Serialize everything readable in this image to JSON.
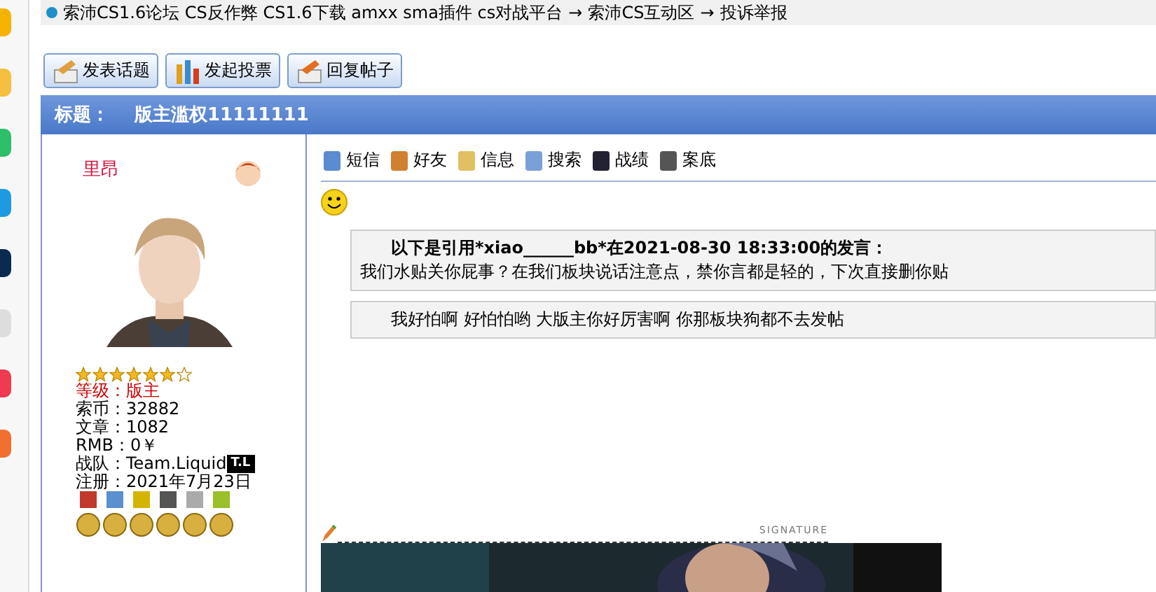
{
  "breadcrumb": [
    "索沛CS1.6论坛 CS反作弊 CS1.6下载 amxx sma插件 cs对战平台",
    "→",
    "索沛CS互动区",
    "→",
    "投诉举报"
  ],
  "action_buttons": [
    {
      "label": "发表话题",
      "kind": "post"
    },
    {
      "label": "发起投票",
      "kind": "poll"
    },
    {
      "label": "回复帖子",
      "kind": "reply"
    }
  ],
  "topic": {
    "label": "标题：",
    "title": "版主滥权11111111"
  },
  "author": {
    "name": "里昂",
    "stars": 6,
    "fields": [
      {
        "label": "等级：",
        "value": "版主",
        "highlight": true
      },
      {
        "label": "索币：",
        "value": "32882",
        "highlight": false
      },
      {
        "label": "文章：",
        "value": "1082",
        "highlight": false
      },
      {
        "label": "RMB：",
        "value": "0￥",
        "highlight": false
      },
      {
        "label": "战队：",
        "value": "Team.Liquid",
        "highlight": false,
        "badge": "T.L"
      },
      {
        "label": "注册：",
        "value": "2021年7月23日",
        "highlight": false
      }
    ],
    "medals": [
      {
        "kind": "cross"
      },
      {
        "kind": "star"
      },
      {
        "kind": "seal"
      },
      {
        "kind": "badge"
      },
      {
        "kind": "horse"
      },
      {
        "kind": "gold"
      }
    ]
  },
  "post_tools": [
    {
      "label": "短信",
      "kind": "message"
    },
    {
      "label": "好友",
      "kind": "friends"
    },
    {
      "label": "信息",
      "kind": "info"
    },
    {
      "label": "搜索",
      "kind": "search"
    },
    {
      "label": "战绩",
      "kind": "soldier"
    },
    {
      "label": "案底",
      "kind": "record"
    }
  ],
  "quote": {
    "header": "以下是引用*xiao______bb*在2021-08-30 18:33:00的发言：",
    "text": "我们水贴关你屁事？在我们板块说话注意点，禁你言都是轻的，下次直接删你贴"
  },
  "reply_text": "我好怕啊 好怕怕哟 大版主你好厉害啊 你那板块狗都不去发帖",
  "signature": {
    "label": "SIGNATURE"
  }
}
